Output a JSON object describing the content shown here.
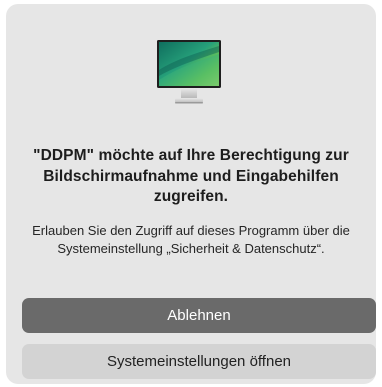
{
  "dialog": {
    "icon": "monitor-display-icon",
    "title": "\"DDPM\" möchte auf Ihre Berechtigung zur Bildschirmaufnahme und Eingabehilfen zugreifen.",
    "message": "Erlauben Sie den Zugriff auf dieses Programm über die Systemeinstellung „Sicherheit & Datenschutz“.",
    "buttons": {
      "deny_label": "Ablehnen",
      "open_settings_label": "Systemeinstellungen öffnen"
    }
  },
  "colors": {
    "dialog_background": "#e6e6e6",
    "primary_button": "#6a6a6a",
    "secondary_button": "#d3d3d3"
  }
}
